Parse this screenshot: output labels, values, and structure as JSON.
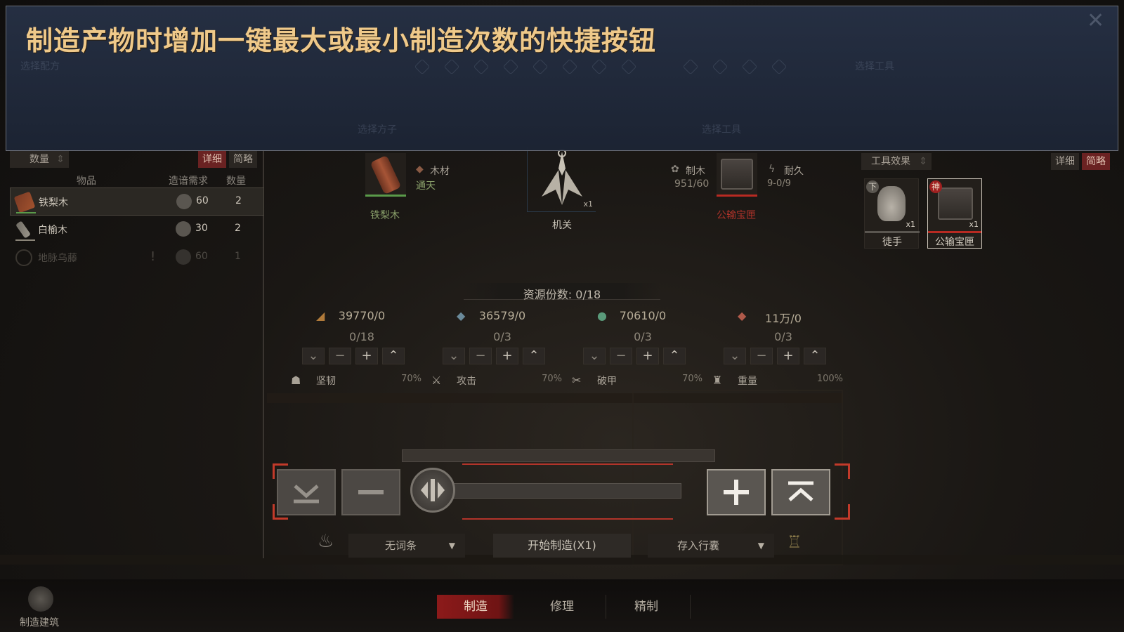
{
  "banner": {
    "title": "制造产物时增加一键最大或最小制造次数的快捷按钮",
    "ghost_texts": [
      "选择配方",
      "选择工具",
      "选择方子",
      "选择工具",
      "选择工具"
    ]
  },
  "left_panel": {
    "sort_label": "数量",
    "tab_detail": "详细",
    "tab_brief": "简略",
    "headers": {
      "item": "物品",
      "requirement": "造谙需求",
      "quantity": "数量"
    },
    "items": [
      {
        "name": "铁梨木",
        "requirement": "60",
        "quantity": "2",
        "selected": true,
        "available": true
      },
      {
        "name": "白榆木",
        "requirement": "30",
        "quantity": "2",
        "selected": false,
        "available": true
      },
      {
        "name": "地脉乌藤",
        "requirement": "60",
        "quantity": "1",
        "selected": false,
        "available": false
      }
    ]
  },
  "center_top": {
    "material_name": "铁梨木",
    "material_type_label": "木材",
    "material_type_value": "通天",
    "product_name": "机关",
    "product_count": "x1",
    "skill_label": "制木",
    "skill_value": "951/60",
    "durability_label": "耐久",
    "durability_value": "9-0/9",
    "tool_name": "公输宝匣"
  },
  "right_panel": {
    "filter_label": "工具效果",
    "tab_detail": "详细",
    "tab_brief": "简略",
    "tools": [
      {
        "name": "徒手",
        "count": "x1",
        "badge": "下",
        "selected": false
      },
      {
        "name": "公输宝匣",
        "count": "x1",
        "badge": "神",
        "selected": true
      }
    ]
  },
  "resources": {
    "portions_label": "资源份数: 0/18",
    "columns": [
      {
        "total": "39770/0",
        "count": "0/18",
        "stat": "坚韧",
        "percent": "70%"
      },
      {
        "total": "36579/0",
        "count": "0/3",
        "stat": "攻击",
        "percent": "70%"
      },
      {
        "total": "70610/0",
        "count": "0/3",
        "stat": "破甲",
        "percent": "70%"
      },
      {
        "total": "11万/0",
        "count": "0/3",
        "stat": "重量",
        "percent": "100%"
      }
    ]
  },
  "slider": {
    "value_fraction": 0.0
  },
  "bottom": {
    "affix_select": "无词条",
    "start_button": "开始制造(X1)",
    "store_select": "存入行囊",
    "build_label": "制造建筑"
  },
  "tabs": [
    {
      "label": "制造",
      "active": true
    },
    {
      "label": "修理",
      "active": false
    },
    {
      "label": "精制",
      "active": false
    }
  ],
  "colors": {
    "banner_title": "#efc98a",
    "accent_red": "#c23a2a",
    "panel_bg": "#1a1714"
  }
}
